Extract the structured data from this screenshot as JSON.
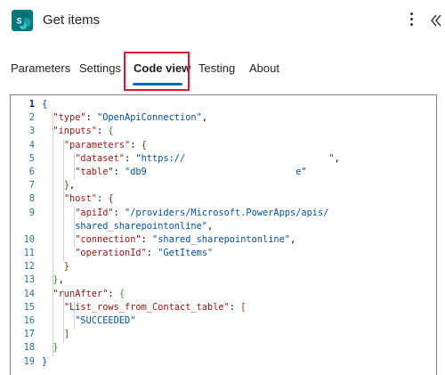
{
  "header": {
    "title": "Get items",
    "app_icon": "sharepoint-icon",
    "more_icon": "more-vertical-icon",
    "collapse_icon": "double-chevron-left-icon"
  },
  "tabs": [
    {
      "label": "Parameters",
      "active": false
    },
    {
      "label": "Settings",
      "active": false
    },
    {
      "label": "Code view",
      "active": true
    },
    {
      "label": "Testing",
      "active": false
    },
    {
      "label": "About",
      "active": false
    }
  ],
  "colors": {
    "accent": "#0f6cbd",
    "highlight_box": "#e3102b",
    "sharepoint": "#03787c",
    "json_key": "#a31515",
    "json_string": "#0451a5",
    "line_number": "#237893"
  },
  "code": {
    "line_numbers": [
      "1",
      "2",
      "3",
      "4",
      "5",
      "6",
      "7",
      "8",
      "9",
      "",
      "10",
      "11",
      "12",
      "13",
      "14",
      "15",
      "16",
      "17",
      "18",
      "19"
    ],
    "tokens": {
      "type_key": "\"type\"",
      "type_val": "\"OpenApiConnection\"",
      "inputs_key": "\"inputs\"",
      "parameters_key": "\"parameters\"",
      "dataset_key": "\"dataset\"",
      "dataset_val": "\"https://",
      "dataset_tail": "\"",
      "table_key": "\"table\"",
      "table_val": "\"db9",
      "table_tail": "e\"",
      "host_key": "\"host\"",
      "apiId_key": "\"apiId\"",
      "apiId_val_1": "\"/providers/Microsoft.PowerApps/apis/",
      "apiId_val_2": "shared_sharepointonline\"",
      "connection_key": "\"connection\"",
      "connection_val": "\"shared_sharepointonline\"",
      "operationId_key": "\"operationId\"",
      "operationId_val": "\"GetItems\"",
      "runAfter_key": "\"runAfter\"",
      "list_rows_key": "\"List_rows_from_Contact_table\"",
      "succeeded_val": "\"SUCCEEDED\""
    }
  }
}
